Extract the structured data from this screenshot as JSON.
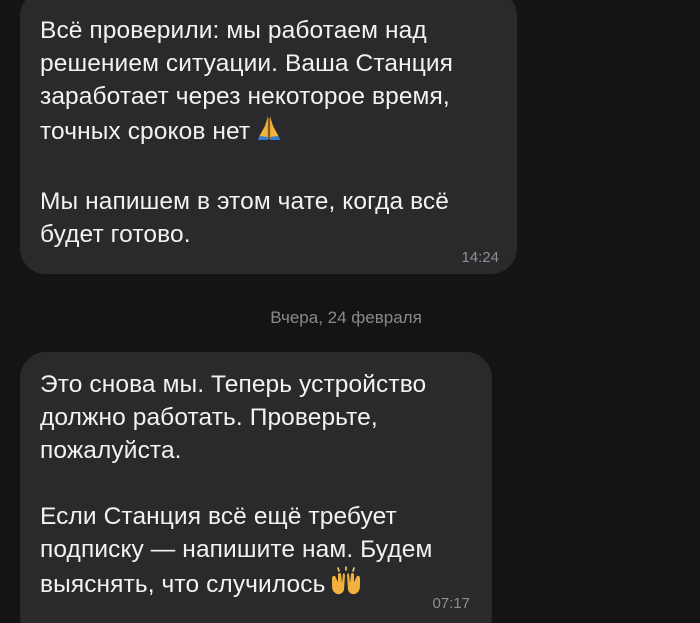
{
  "messages": [
    {
      "paragraphs": [
        "Всё проверили: мы работаем над\nрешением ситуации. Ваша Станция\nзаработает через некоторое время,\nточных сроков нет",
        "Мы напишем в этом чате, когда всё\nбудет готово."
      ],
      "emoji": "praying-hands-emoji",
      "time": "14:24"
    },
    {
      "paragraphs": [
        "Это снова мы. Теперь устройство\nдолжно работать. Проверьте,\nпожалуйста.",
        "Если Станция всё ещё требует\nподписку — напишите нам. Будем\nвыяснять, что случилось"
      ],
      "emoji": "raising-hands-emoji",
      "time": "07:17"
    }
  ],
  "date_separator": "Вчера, 24 февраля",
  "colors": {
    "background": "#141414",
    "bubble": "#2a2a2c",
    "text": "#f2f2f2",
    "meta": "#8f8f93"
  }
}
